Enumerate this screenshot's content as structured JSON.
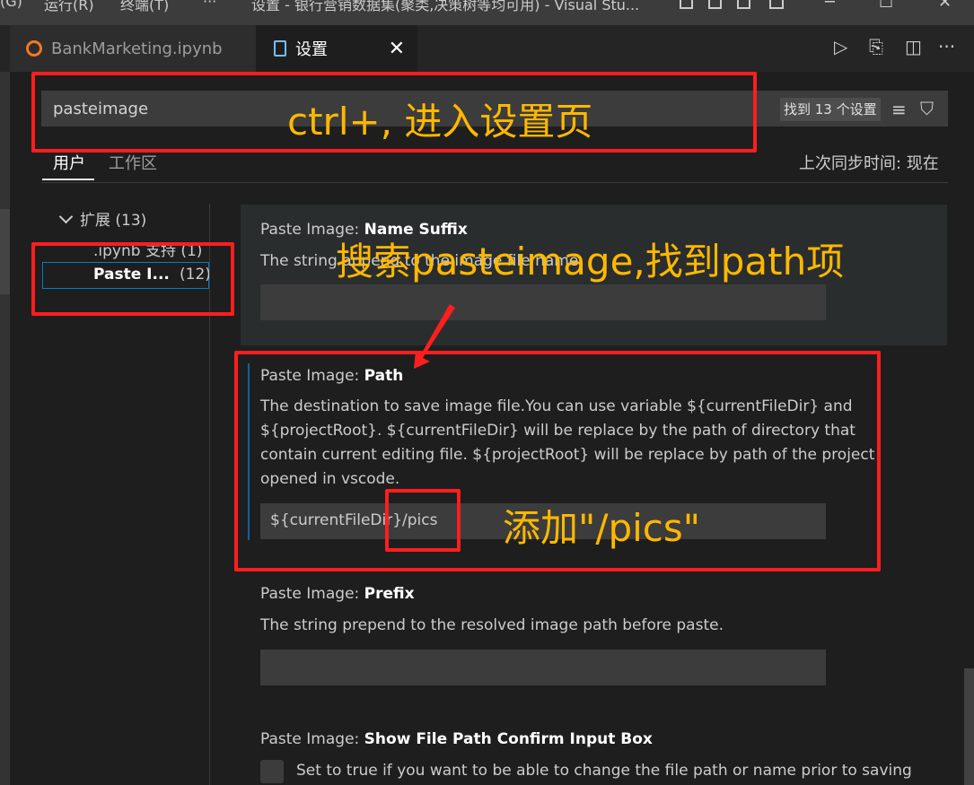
{
  "window": {
    "menu_go": "(G)",
    "menu_run": "运行(R)",
    "menu_terminal": "终端(T)",
    "menu_more": "···",
    "title": "设置 - 银行营销数据集(聚类,决策树等均可用) - Visual Stu..."
  },
  "tabs": {
    "notebook_label": "BankMarketing.ipynb",
    "settings_label": "设置",
    "close_symbol": "✕"
  },
  "search": {
    "value": "pasteimage",
    "result_count": "找到 13 个设置"
  },
  "scopes": {
    "user": "用户",
    "workspace": "工作区",
    "sync_status": "上次同步时间: 现在"
  },
  "toc": {
    "extensions": "扩展 (13)",
    "ipynb_support": ".ipynb 支持 (1)",
    "paste_label": "Paste I...",
    "paste_count": "(12)"
  },
  "settings": {
    "name_suffix": {
      "prefix_title": "Paste Image: ",
      "name": "Name Suffix",
      "description": "The string append to the image file name."
    },
    "path": {
      "prefix_title": "Paste Image: ",
      "name": "Path",
      "description": "The destination to save image file.You can use variable ${currentFileDir} and ${projectRoot}. ${currentFileDir} will be replace by the path of directory that contain current editing file. ${projectRoot} will be replace by path of the project opened in vscode.",
      "value": "${currentFileDir}/pics"
    },
    "prefix": {
      "prefix_title": "Paste Image: ",
      "name": "Prefix",
      "description": "The string prepend to the resolved image path before paste."
    },
    "confirm": {
      "prefix_title": "Paste Image: ",
      "name": "Show File Path Confirm Input Box",
      "description": "Set to true if you want to be able to change the file path or name prior to saving"
    }
  },
  "annotations": {
    "open_settings": "ctrl+, 进入设置页",
    "search_hint": "搜索pasteimage,找到path项",
    "add_pics": "添加\"/pics\""
  },
  "colors": {
    "annotation_text": "#ffb800",
    "annotation_box": "#ff1e1e",
    "focus_bar": "#0e639c"
  }
}
